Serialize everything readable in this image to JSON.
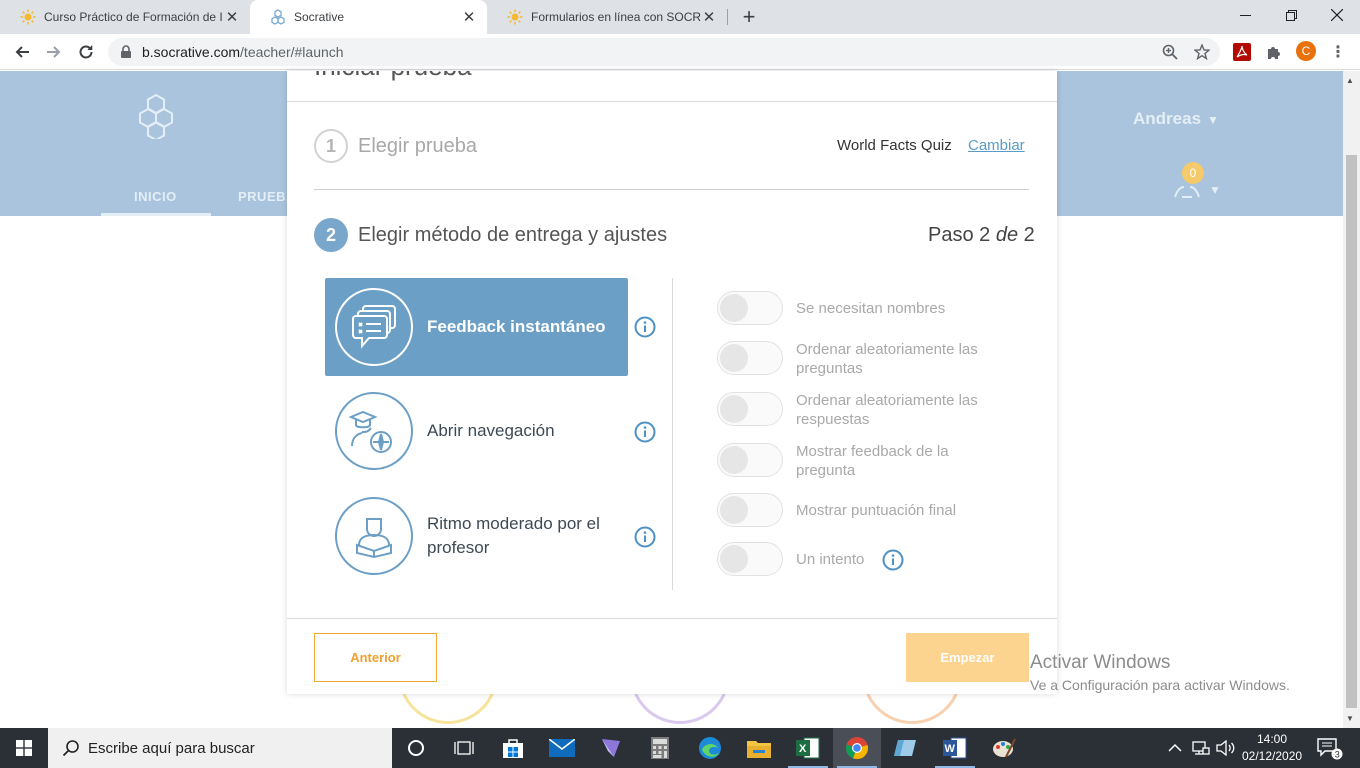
{
  "browser": {
    "tabs": [
      {
        "title": "Curso Práctico de Formación de I",
        "active": false
      },
      {
        "title": "Socrative",
        "active": true
      },
      {
        "title": "Formularios en línea con SOCRATIVE",
        "active": false
      }
    ],
    "url_host": "b.socrative.com",
    "url_path": "/teacher/#launch",
    "profile_initial": "C"
  },
  "app": {
    "nav": [
      "INICIO",
      "PRUEBAS"
    ],
    "username": "Andreas",
    "notifications": "0"
  },
  "modal": {
    "title": "Iniciar prueba",
    "step1": {
      "number": "1",
      "label": "Elegir prueba",
      "quiz_name": "World Facts Quiz",
      "change_label": "Cambiar"
    },
    "step2": {
      "number": "2",
      "label": "Elegir método de entrega y ajustes",
      "step_prefix": "Paso 2",
      "step_de": "de",
      "step_total": "2"
    },
    "methods": [
      {
        "label": "Feedback instantáneo",
        "selected": true
      },
      {
        "label": "Abrir navegación",
        "selected": false
      },
      {
        "label": "Ritmo moderado por el profesor",
        "selected": false
      }
    ],
    "settings": [
      {
        "label": "Se necesitan nombres",
        "on": false
      },
      {
        "label": "Ordenar aleatoriamente las preguntas",
        "on": false
      },
      {
        "label": "Ordenar aleatoriamente las respuestas",
        "on": false
      },
      {
        "label": "Mostrar feedback de la pregunta",
        "on": false
      },
      {
        "label": "Mostrar puntuación final",
        "on": false
      },
      {
        "label": "Un intento",
        "on": false
      }
    ],
    "prev_label": "Anterior",
    "start_label": "Empezar"
  },
  "watermark": {
    "line1": "Activar Windows",
    "line2": "Ve a Configuración para activar Windows."
  },
  "taskbar": {
    "search_placeholder": "Escribe aquí para buscar",
    "time": "14:00",
    "date": "02/12/2020",
    "notification_count": "3"
  },
  "colors": {
    "brand_blue": "#6c9fc6",
    "header_blue": "#a9c4dc",
    "accent_orange": "#f0a030",
    "start_disabled": "#fcd38f"
  }
}
